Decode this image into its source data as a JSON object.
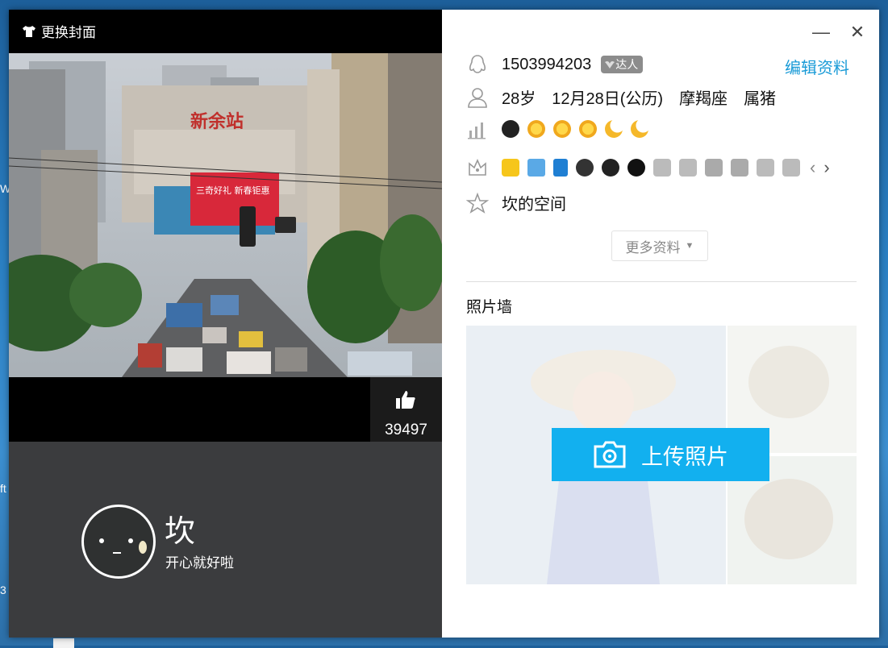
{
  "desktop": {
    "edge_texts": [
      "W",
      "ft",
      "3"
    ]
  },
  "cover_panel": {
    "change_cover_label": "更换封面",
    "like_count": "39497",
    "nickname": "坎",
    "signature": "开心就好啦",
    "photo_signs": {
      "station": "新余站",
      "banner": "三奇好礼 新春钜惠"
    }
  },
  "window_controls": {
    "minimize": "—",
    "close": "✕"
  },
  "profile": {
    "qq_number": "1503994203",
    "expert_badge": "达人",
    "edit_label": "编辑资料",
    "age": "28岁",
    "birthday": "12月28日(公历)",
    "zodiac": "摩羯座",
    "chinese_zodiac": "属猪",
    "level_icons": [
      "penguin-icon",
      "sun-icon",
      "sun-icon",
      "sun-icon",
      "moon-icon",
      "moon-icon"
    ],
    "privilege_icons": [
      "star-icon",
      "mail-icon",
      "phone-icon",
      "penguin-icon",
      "penguin-icon",
      "penguin-icon",
      "diamond-icon",
      "diamond-icon",
      "diamond-icon",
      "diamond-icon",
      "diamond-icon",
      "diamond-icon"
    ],
    "space_label": "坎的空间",
    "more_info_label": "更多资料",
    "photo_wall_title": "照片墙",
    "upload_label": "上传照片"
  },
  "colors": {
    "accent": "#1a9bd7",
    "upload_bg": "#12b0ef",
    "cover_bottom": "#3b3c3e"
  }
}
